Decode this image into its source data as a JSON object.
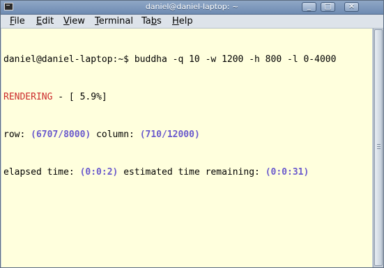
{
  "window": {
    "title": "daniel@daniel-laptop: ~",
    "minimize_glyph": "_",
    "maximize_glyph": "□",
    "close_glyph": "×"
  },
  "menu": [
    {
      "label": "File",
      "mnemonic": "F",
      "rest": "ile"
    },
    {
      "label": "Edit",
      "mnemonic": "E",
      "rest": "dit"
    },
    {
      "label": "View",
      "mnemonic": "V",
      "rest": "iew"
    },
    {
      "label": "Terminal",
      "mnemonic": "T",
      "rest": "erminal"
    },
    {
      "label": "Tabs",
      "pre": "Ta",
      "mnemonic": "b",
      "rest": "s"
    },
    {
      "label": "Help",
      "mnemonic": "H",
      "rest": "elp"
    }
  ],
  "terminal": {
    "prompt": "daniel@daniel-laptop:~$ ",
    "command": "buddha -q 10 -w 1200 -h 800 -l 0-4000",
    "status_label": "RENDERING",
    "status_rest": " - [ 5.9%]",
    "row_label": "row: ",
    "row_value": "(6707/8000)",
    "column_label": " column: ",
    "column_value": "(710/12000)",
    "elapsed_label": "elapsed time: ",
    "elapsed_value": "(0:0:2)",
    "remaining_label": " estimated time remaining: ",
    "remaining_value": "(0:0:31)"
  },
  "colors": {
    "terminal_bg": "#ffffdd",
    "status_red": "#cc2b2b",
    "value_blue": "#6a5acd"
  }
}
